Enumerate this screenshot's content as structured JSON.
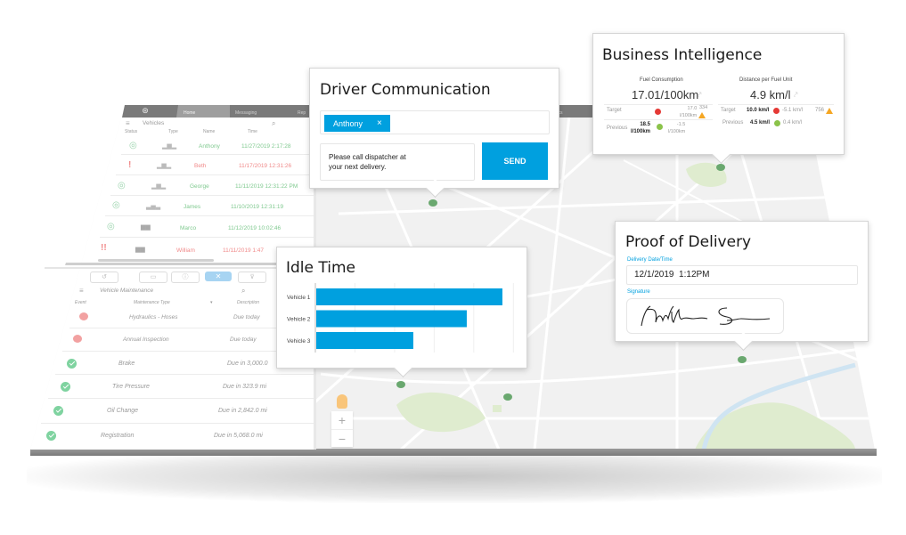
{
  "app": {
    "nav_tabs": [
      {
        "label": "Home",
        "icon": "home-icon"
      },
      {
        "label": "Messaging",
        "icon": "message-icon"
      },
      {
        "label": "Rep",
        "icon": "report-icon"
      },
      {
        "label": "tics",
        "icon": "analytics-icon"
      }
    ],
    "logo_icon": "steering-wheel-icon"
  },
  "vehicles_panel": {
    "title": "Vehicles",
    "columns": [
      "Status",
      "Type",
      "Name",
      "Time"
    ],
    "rows": [
      {
        "status": "ok",
        "name": "Anthony",
        "time": "11/27/2019 2:17:28",
        "color": "#7fc98f"
      },
      {
        "status": "alert",
        "status_glyph": "!",
        "name": "Beth",
        "time": "11/17/2019 12:31:26",
        "color": "#f08a8a"
      },
      {
        "status": "ok",
        "name": "George",
        "time": "11/11/2019 12:31:22 PM",
        "color": "#7fc98f"
      },
      {
        "status": "ok",
        "name": "James",
        "time": "11/10/2019 12:31:19",
        "color": "#7fc98f"
      },
      {
        "status": "ok",
        "name": "Marco",
        "time": "11/12/2019 10:02:46",
        "color": "#7fc98f"
      },
      {
        "status": "alert",
        "status_glyph": "!!",
        "name": "William",
        "time": "11/11/2019 1:47",
        "color": "#f08a8a"
      }
    ]
  },
  "maintenance_panel": {
    "toolbar_icons": [
      "history-icon",
      "card-icon",
      "info-icon",
      "wrench-icon",
      "filter-icon"
    ],
    "title": "Vehicle Maintenance",
    "columns": [
      "Event",
      "Maintenance Type",
      "Description"
    ],
    "rows": [
      {
        "status": "error",
        "type": "Hydraulics - Hoses",
        "description": "Due today"
      },
      {
        "status": "error",
        "type": "Annual Inspection",
        "description": "Due today"
      },
      {
        "status": "ok",
        "type": "Brake",
        "description": "Due in 3,000.0"
      },
      {
        "status": "ok",
        "type": "Tire Pressure",
        "description": "Due in 323.9 mi"
      },
      {
        "status": "ok",
        "type": "Oil Change",
        "description": "Due in 2,842.0 mi"
      },
      {
        "status": "ok",
        "type": "Registration",
        "description": "Due in 5,068.0 mi"
      }
    ]
  },
  "map": {
    "zoom_in": "+",
    "zoom_out": "−",
    "colors": {
      "background": "#f1f1f1",
      "park": "#dfeccf",
      "river": "#cfe4f2",
      "pin": "#6aa86f"
    }
  },
  "driver_communication": {
    "title": "Driver Communication",
    "recipient": "Anthony",
    "remove_glyph": "×",
    "message": "Please call dispatcher at your next delivery.",
    "message_line1": "Please call dispatcher at",
    "message_line2": "your next delivery.",
    "send_label": "SEND"
  },
  "business_intelligence": {
    "title": "Business Intelligence",
    "fuel": {
      "label": "Fuel Consumption",
      "value": "17.01/100km",
      "target_label": "Target",
      "target_delta": "17.0",
      "target_delta_unit": "l/100km",
      "target_count": "334",
      "previous_label": "Previous",
      "previous_value": "18.5",
      "previous_unit": "l/100km",
      "previous_delta": "-1.5",
      "previous_delta_unit": "l/100km"
    },
    "distance": {
      "label": "Distance per Fuel Unit",
      "value": "4.9 km/l",
      "target_label": "Target",
      "target_value": "10.0 km/l",
      "target_delta": "-5.1 km/l",
      "target_count": "756",
      "previous_label": "Previous",
      "previous_value": "4.5 km/l",
      "previous_delta": "0.4 km/l"
    },
    "colors": {
      "error": "#e53935",
      "ok": "#8bc34a",
      "warning": "#f5a623"
    }
  },
  "proof_of_delivery": {
    "title": "Proof of Delivery",
    "date_label": "Delivery Date/Time",
    "date_value": "12/1/2019  1:12PM",
    "signature_label": "Signature",
    "signature_text": "Matthew Sen"
  },
  "chart_data": {
    "type": "bar",
    "orientation": "horizontal",
    "title": "Idle Time",
    "categories": [
      "Vehicle 1",
      "Vehicle 2",
      "Vehicle 3"
    ],
    "values": [
      4.7,
      3.8,
      2.45
    ],
    "xlabel": "",
    "ylabel": "",
    "xlim": [
      0,
      5
    ],
    "grid": true,
    "legend": "none",
    "bar_color": "#00a0df"
  }
}
